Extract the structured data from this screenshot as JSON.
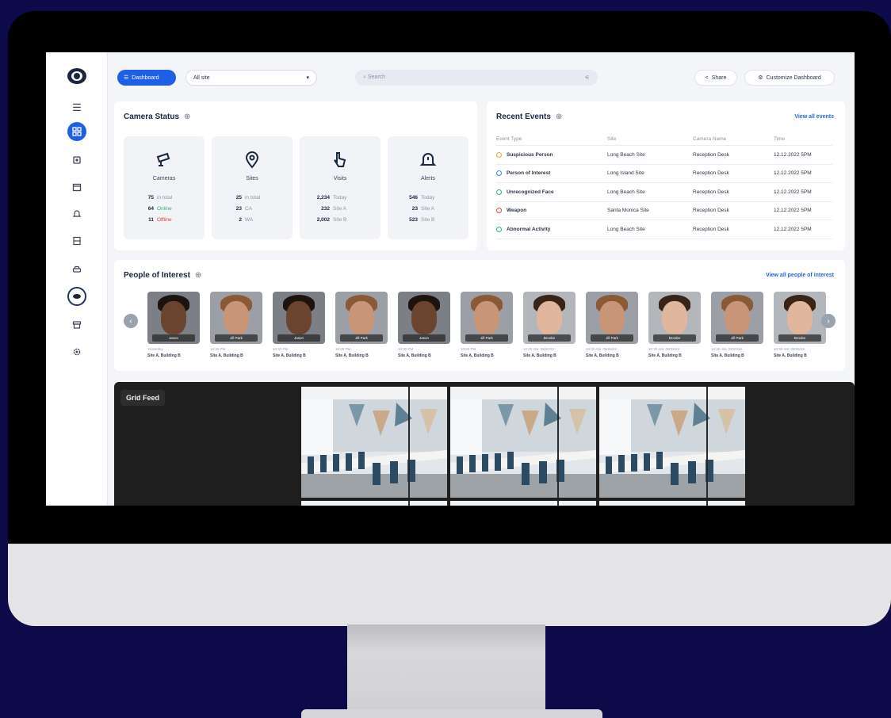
{
  "topbar": {
    "dashboard_label": "Dashboard",
    "site_select": "All site",
    "search_placeholder": "Search",
    "share_label": "Share",
    "customize_label": "Customize Dashboard"
  },
  "camera_status": {
    "title": "Camera Status",
    "cards": [
      {
        "label": "Cameras",
        "icon": "camera-icon",
        "rows": [
          {
            "num": "75",
            "txt": "in total",
            "tone": ""
          },
          {
            "num": "64",
            "txt": "Online",
            "tone": "green"
          },
          {
            "num": "11",
            "txt": "Offline",
            "tone": "red"
          }
        ]
      },
      {
        "label": "Sites",
        "icon": "map-pin-icon",
        "rows": [
          {
            "num": "25",
            "txt": "in total",
            "tone": ""
          },
          {
            "num": "23",
            "txt": "CA",
            "tone": ""
          },
          {
            "num": "2",
            "txt": "WA",
            "tone": ""
          }
        ]
      },
      {
        "label": "Visits",
        "icon": "pointer-icon",
        "rows": [
          {
            "num": "2,234",
            "txt": "Today",
            "tone": ""
          },
          {
            "num": "232",
            "txt": "Site A",
            "tone": ""
          },
          {
            "num": "2,002",
            "txt": "Site B",
            "tone": ""
          }
        ]
      },
      {
        "label": "Alerts",
        "icon": "bell-icon",
        "rows": [
          {
            "num": "546",
            "txt": "Today",
            "tone": ""
          },
          {
            "num": "23",
            "txt": "Site A",
            "tone": ""
          },
          {
            "num": "523",
            "txt": "Site B",
            "tone": ""
          }
        ]
      }
    ]
  },
  "recent_events": {
    "title": "Recent Events",
    "view_all": "View all events",
    "headers": [
      "Event Type",
      "Site",
      "Camera Name",
      "Time"
    ],
    "rows": [
      {
        "type": "Suspicious Person",
        "site": "Long Beach Site",
        "camera": "Reception Desk",
        "time": "12.12.2022 5PM",
        "color": "#f0a23a"
      },
      {
        "type": "Person of Interest",
        "site": "Long Island Site",
        "camera": "Reception Desk",
        "time": "12.12.2022 5PM",
        "color": "#3b82f6"
      },
      {
        "type": "Unrecognized Face",
        "site": "Long Beach Site",
        "camera": "Reception Desk",
        "time": "12.12.2022 5PM",
        "color": "#2fb46b"
      },
      {
        "type": "Weapon",
        "site": "Santa Monica Site",
        "camera": "Reception Desk",
        "time": "12.12.2022 5PM",
        "color": "#e04848"
      },
      {
        "type": "Abnormal Activity",
        "site": "Long Beach Site",
        "camera": "Reception Desk",
        "time": "12.12.2022 5PM",
        "color": "#2fb46b"
      }
    ]
  },
  "people_of_interest": {
    "title": "People of Interest",
    "view_all": "View all people of interest",
    "people": [
      {
        "name": "Jason",
        "time": "Yesterday",
        "loc": "Site A, Building B",
        "skin": "#6b4430",
        "hair": "#1d1410",
        "bg": "#7c7f86"
      },
      {
        "name": "Jill Park",
        "time": "10:30 PM",
        "loc": "Site A, Building B",
        "skin": "#c99579",
        "hair": "#8a5a36",
        "bg": "#9c9fa6"
      },
      {
        "name": "Jason",
        "time": "10:30 PM",
        "loc": "Site A, Building B",
        "skin": "#6b4430",
        "hair": "#1d1410",
        "bg": "#7c7f86"
      },
      {
        "name": "Jill Park",
        "time": "10:30 PM",
        "loc": "Site A, Building B",
        "skin": "#c99579",
        "hair": "#8a5a36",
        "bg": "#9c9fa6"
      },
      {
        "name": "Jason",
        "time": "10:30 PM",
        "loc": "Site A, Building B",
        "skin": "#6b4430",
        "hair": "#1d1410",
        "bg": "#7c7f86"
      },
      {
        "name": "Jill Park",
        "time": "10:30 PM",
        "loc": "Site A, Building B",
        "skin": "#c99579",
        "hair": "#8a5a36",
        "bg": "#9c9fa6"
      },
      {
        "name": "Brooke",
        "time": "10:30 AM, 09/25/22",
        "loc": "Site A, Building B",
        "skin": "#e0b79d",
        "hair": "#3a2418",
        "bg": "#b3b6bb"
      },
      {
        "name": "Jill Park",
        "time": "10:30 AM, 09/25/22",
        "loc": "Site A, Building B",
        "skin": "#c99579",
        "hair": "#8a5a36",
        "bg": "#9c9fa6"
      },
      {
        "name": "Brooke",
        "time": "10:30 AM, 09/25/22",
        "loc": "Site A, Building B",
        "skin": "#e0b79d",
        "hair": "#3a2418",
        "bg": "#b3b6bb"
      },
      {
        "name": "Jill Park",
        "time": "10:30 AM, 09/25/22",
        "loc": "Site A, Building B",
        "skin": "#c99579",
        "hair": "#8a5a36",
        "bg": "#9c9fa6"
      },
      {
        "name": "Brooke",
        "time": "10:30 AM, 09/25/22",
        "loc": "Site A, Building B",
        "skin": "#e0b79d",
        "hair": "#3a2418",
        "bg": "#b3b6bb"
      }
    ]
  },
  "grid_feed": {
    "title": "Grid Feed"
  },
  "colors": {
    "accent": "#1f5fe6",
    "background": "#0d0a4a",
    "link": "#2563eb"
  }
}
